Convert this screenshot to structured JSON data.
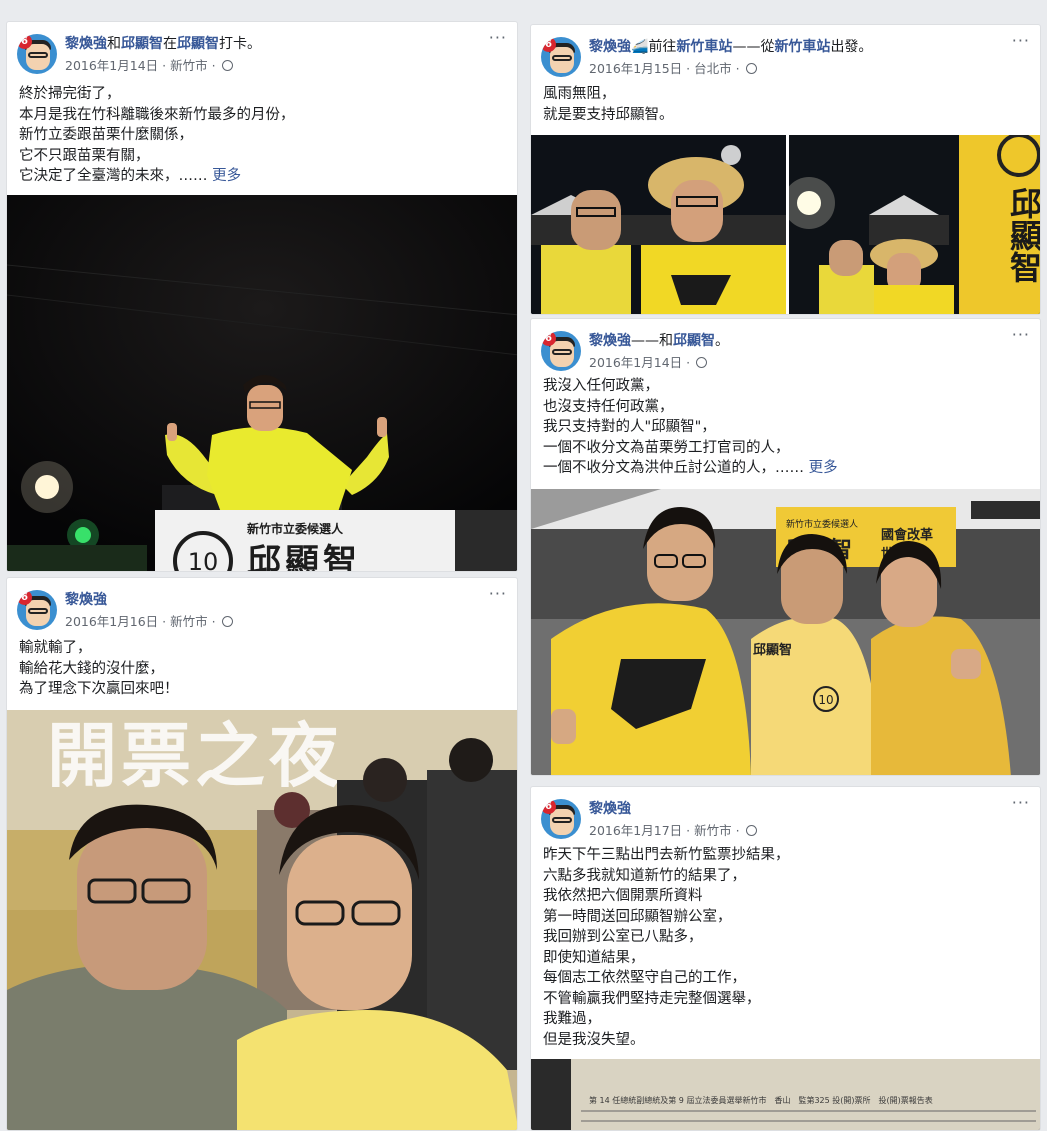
{
  "posts": [
    {
      "author": "黎煥強",
      "title_connector": "和",
      "tagged": "邱顯智",
      "location_prefix": "在",
      "location": "邱顯智",
      "action": "打卡。",
      "date": "2016年1月14日",
      "place": "新竹市",
      "lines": [
        "終於掃完街了，",
        "本月是我在竹科離職後來新竹最多的月份，",
        "新竹立委跟苗栗什麼關係，",
        "它不只跟苗栗有關，",
        "它決定了全臺灣的未來，……"
      ],
      "see_more": "更多",
      "photo_text": "新竹市立委候選人",
      "photo_name": "邱顯智",
      "photo_number": "10"
    },
    {
      "author": "黎煥強",
      "action_prefix": "前往",
      "dest": "新竹車站",
      "dash": "——從",
      "origin": "新竹車站",
      "action": "出發。",
      "date": "2016年1月15日",
      "place": "台北市",
      "lines": [
        "風雨無阻，",
        "就是要支持邱顯智。"
      ],
      "sign_text": "邱顯智"
    },
    {
      "author": "黎煥強",
      "dash": "——和",
      "tagged": "邱顯智",
      "end": "。",
      "date": "2016年1月14日",
      "lines": [
        "我沒入任何政黨，",
        "也沒支持任何政黨，",
        "我只支持對的人\"邱顯智\"，",
        "一個不收分文為苗栗勞工打官司的人，",
        "一個不收分文為洪仲丘討公道的人，……"
      ],
      "see_more": "更多",
      "banner_small": "新竹市立委候選人",
      "banner_name": "邱顯智",
      "banner_slogan1": "國會改革",
      "banner_slogan2": "世代交替",
      "vest_name": "邱顯智",
      "badge": "10"
    },
    {
      "author": "黎煥強",
      "date": "2016年1月16日",
      "place": "新竹市",
      "lines": [
        "輸就輸了，",
        "輸給花大錢的沒什麼，",
        "為了理念下次贏回來吧！"
      ],
      "poster_text": "開票之夜"
    },
    {
      "author": "黎煥強",
      "date": "2016年1月17日",
      "place": "新竹市",
      "lines": [
        "昨天下午三點出門去新竹監票抄結果，",
        "六點多我就知道新竹的結果了，",
        "我依然把六個開票所資料",
        "第一時間送回邱顯智辦公室，",
        "我回辦到公室已八點多，",
        "即使知道結果，",
        "每個志工依然堅守自己的工作，",
        "不管輸贏我們堅持走完整個選舉，",
        "我難過，",
        "但是我沒失望。"
      ],
      "doc_text": "第 14 任總統副總統及第 9 屆立法委員選舉新竹市　香山　監第325 投(開)票所　投(開)票報告表"
    }
  ],
  "avatar_badge": "6",
  "more_icon": "···",
  "meta_sep": " · ",
  "colors": {
    "link": "#385898",
    "campaign_yellow": "#f2d21b"
  }
}
